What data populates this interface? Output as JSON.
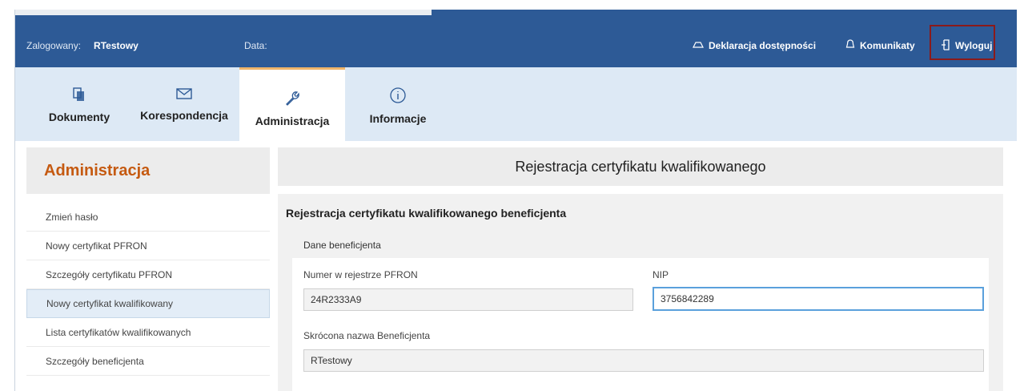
{
  "header": {
    "logged_label": "Zalogowany:",
    "user": "RTestowy",
    "date_label": "Data:",
    "accessibility": "Deklaracja dostępności",
    "messages": "Komunikaty",
    "logout": "Wyloguj"
  },
  "tabs": [
    {
      "label": "Dokumenty",
      "icon": "documents-icon"
    },
    {
      "label": "Korespondencja",
      "icon": "envelope-icon"
    },
    {
      "label": "Administracja",
      "icon": "wrench-icon"
    },
    {
      "label": "Informacje",
      "icon": "info-icon"
    }
  ],
  "sidebar": {
    "title": "Administracja",
    "items": [
      {
        "label": "Zmień hasło"
      },
      {
        "label": "Nowy certyfikat PFRON"
      },
      {
        "label": "Szczegóły certyfikatu PFRON"
      },
      {
        "label": "Nowy certyfikat kwalifikowany"
      },
      {
        "label": "Lista certyfikatów kwalifikowanych"
      },
      {
        "label": "Szczegóły beneficjenta"
      }
    ]
  },
  "main": {
    "title": "Rejestracja certyfikatu kwalifikowanego",
    "section_title": "Rejestracja certyfikatu kwalifikowanego beneficjenta",
    "box_title": "Dane beneficjenta",
    "fields": {
      "pfron_label": "Numer w rejestrze PFRON",
      "pfron_value": "24R2333A9",
      "nip_label": "NIP",
      "nip_value": "3756842289",
      "short_name_label": "Skrócona nazwa Beneficjenta",
      "short_name_value": "RTestowy"
    }
  },
  "colors": {
    "header_bg": "#2d5a96",
    "accent_orange": "#c55a11",
    "logout_highlight": "#8b1a1a",
    "focus_border": "#5aa0dc"
  }
}
